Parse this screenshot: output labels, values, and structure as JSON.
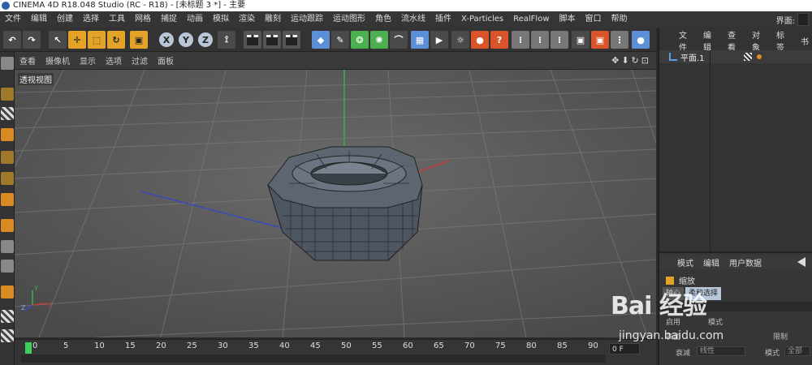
{
  "window": {
    "title": "CINEMA 4D R18.048 Studio (RC - R18) - [未标题 3 *] - 主要"
  },
  "menubar": {
    "items": [
      "文件",
      "编辑",
      "创建",
      "选择",
      "工具",
      "网格",
      "捕捉",
      "动画",
      "模拟",
      "渲染",
      "雕刻",
      "运动跟踪",
      "运动图形",
      "角色",
      "流水线",
      "插件",
      "X-Particles",
      "RealFlow",
      "脚本",
      "窗口",
      "帮助"
    ],
    "layout_label": "界面:",
    "layout_value": ""
  },
  "toolbar": {
    "axis_x": "X",
    "axis_y": "Y",
    "axis_z": "Z"
  },
  "viewport": {
    "menu": [
      "查看",
      "摄像机",
      "显示",
      "选项",
      "过滤",
      "面板"
    ],
    "nav_icons": "✥⬇↻⊡",
    "label": "透视视图",
    "axis_gizmo": {
      "y": "Y",
      "x": "X",
      "z": "Z"
    }
  },
  "timeline": {
    "ticks": [
      "0",
      "5",
      "10",
      "15",
      "20",
      "25",
      "30",
      "35",
      "40",
      "45",
      "50",
      "55",
      "60",
      "65",
      "70",
      "75",
      "80",
      "85",
      "90"
    ],
    "current_frame": "0 F"
  },
  "object_manager": {
    "menu": [
      "文件",
      "编辑",
      "查看",
      "对象",
      "标签",
      "书"
    ],
    "objects": [
      {
        "name": "平面.1"
      }
    ]
  },
  "attribute_manager": {
    "menu": [
      "模式",
      "编辑",
      "用户数据"
    ],
    "title": "缩放",
    "tabs": [
      "轴心",
      "柔和选择"
    ],
    "fields": {
      "enable": "启用",
      "mode": "模式",
      "limit": "限制",
      "surface": "表面",
      "falloff_label": "衰减",
      "falloff_value": "线性",
      "mode2": "模式",
      "mode2_value": "全部"
    }
  },
  "watermark": {
    "logo": "Bai 经验",
    "url": "jingyan.baidu.com"
  },
  "colors": {
    "accent": "#e3a228",
    "timeline_cursor": "#3ecf5a",
    "object_axis": "#5aa0e0"
  }
}
